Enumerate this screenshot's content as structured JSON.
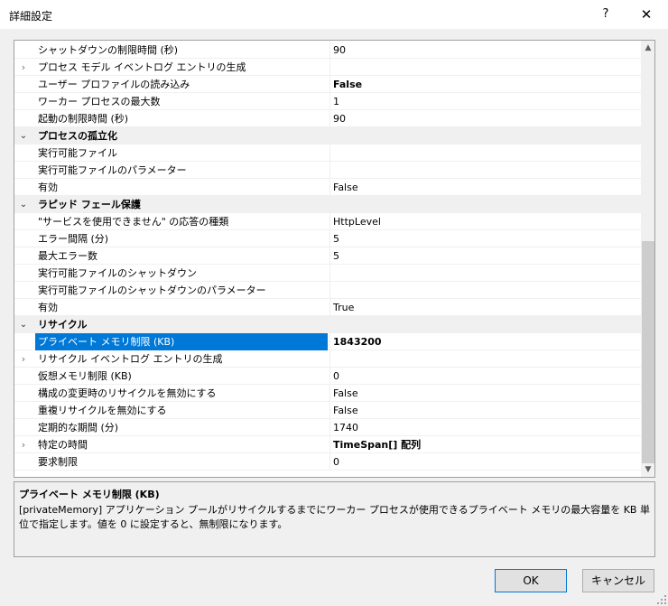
{
  "window": {
    "title": "詳細設定",
    "help": "?",
    "close": "✕"
  },
  "grid": {
    "rows": [
      {
        "kind": "prop",
        "expander": "",
        "name": "シャットダウンの制限時間 (秒)",
        "value": "90"
      },
      {
        "kind": "prop",
        "expander": "›",
        "name": "プロセス モデル イベントログ エントリの生成",
        "value": ""
      },
      {
        "kind": "prop",
        "expander": "",
        "name": "ユーザー プロファイルの読み込み",
        "value": "False",
        "bold": true
      },
      {
        "kind": "prop",
        "expander": "",
        "name": "ワーカー プロセスの最大数",
        "value": "1"
      },
      {
        "kind": "prop",
        "expander": "",
        "name": "起動の制限時間 (秒)",
        "value": "90"
      },
      {
        "kind": "cat",
        "expander": "⌄",
        "name": "プロセスの孤立化"
      },
      {
        "kind": "prop",
        "expander": "",
        "name": "実行可能ファイル",
        "value": ""
      },
      {
        "kind": "prop",
        "expander": "",
        "name": "実行可能ファイルのパラメーター",
        "value": ""
      },
      {
        "kind": "prop",
        "expander": "",
        "name": "有効",
        "value": "False"
      },
      {
        "kind": "cat",
        "expander": "⌄",
        "name": "ラピッド フェール保護"
      },
      {
        "kind": "prop",
        "expander": "",
        "name": "\"サービスを使用できません\" の応答の種類",
        "value": "HttpLevel"
      },
      {
        "kind": "prop",
        "expander": "",
        "name": "エラー間隔 (分)",
        "value": "5"
      },
      {
        "kind": "prop",
        "expander": "",
        "name": "最大エラー数",
        "value": "5"
      },
      {
        "kind": "prop",
        "expander": "",
        "name": "実行可能ファイルのシャットダウン",
        "value": ""
      },
      {
        "kind": "prop",
        "expander": "",
        "name": "実行可能ファイルのシャットダウンのパラメーター",
        "value": ""
      },
      {
        "kind": "prop",
        "expander": "",
        "name": "有効",
        "value": "True"
      },
      {
        "kind": "cat",
        "expander": "⌄",
        "name": "リサイクル"
      },
      {
        "kind": "prop",
        "expander": "",
        "name": "プライベート メモリ制限 (KB)",
        "value": "1843200",
        "selected": true
      },
      {
        "kind": "prop",
        "expander": "›",
        "name": "リサイクル イベントログ エントリの生成",
        "value": ""
      },
      {
        "kind": "prop",
        "expander": "",
        "name": "仮想メモリ制限 (KB)",
        "value": "0"
      },
      {
        "kind": "prop",
        "expander": "",
        "name": "構成の変更時のリサイクルを無効にする",
        "value": "False"
      },
      {
        "kind": "prop",
        "expander": "",
        "name": "重複リサイクルを無効にする",
        "value": "False"
      },
      {
        "kind": "prop",
        "expander": "",
        "name": "定期的な期間 (分)",
        "value": "1740"
      },
      {
        "kind": "prop",
        "expander": "›",
        "name": "特定の時間",
        "value": "TimeSpan[] 配列",
        "bold": true
      },
      {
        "kind": "prop",
        "expander": "",
        "name": "要求制限",
        "value": "0"
      }
    ]
  },
  "scrollbar": {
    "up": "▲",
    "down": "▼"
  },
  "description": {
    "title": "プライベート メモリ制限 (KB)",
    "body": "[privateMemory] アプリケーション プールがリサイクルするまでにワーカー プロセスが使用できるプライベート メモリの最大容量を KB 単位で指定します。値を 0 に設定すると、無制限になります。"
  },
  "buttons": {
    "ok": "OK",
    "cancel": "キャンセル"
  },
  "colors": {
    "selection": "#0078d7",
    "category_bg": "#f0f0f0"
  }
}
